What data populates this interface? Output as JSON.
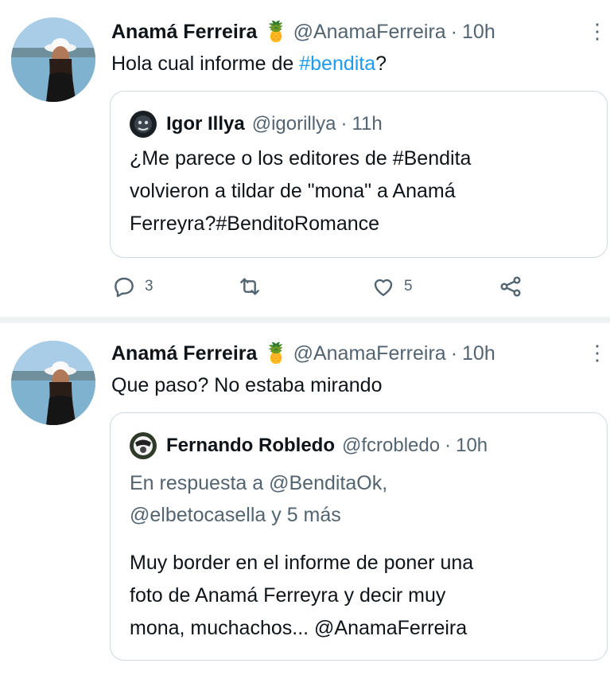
{
  "tweets": [
    {
      "author_name": "Anamá Ferreira",
      "emoji": "🍍",
      "handle": "@AnamaFerreira",
      "separator": "·",
      "time": "10h",
      "text_before": "Hola cual informe de ",
      "text_hashtag": "#bendita",
      "text_after": "?",
      "quote": {
        "author_name": "Igor Illya",
        "handle": "@igorillya",
        "separator": "·",
        "time": "11h",
        "lines": [
          "¿Me parece o los editores de #Bendita",
          "volvieron a tildar de \"mona\" a Anamá",
          "Ferreyra?#BenditoRomance"
        ]
      },
      "actions": {
        "replies": "3",
        "likes": "5"
      }
    },
    {
      "author_name": "Anamá Ferreira",
      "emoji": "🍍",
      "handle": "@AnamaFerreira",
      "separator": "·",
      "time": "10h",
      "text": "Que paso? No estaba mirando",
      "quote": {
        "author_name": "Fernando Robledo",
        "handle": "@fcrobledo",
        "separator": "·",
        "time": "10h",
        "reply_lines": [
          "En respuesta a @BenditaOk,",
          "@elbetocasella y 5 más"
        ],
        "lines": [
          "Muy border en el informe de poner una",
          "foto de Anamá Ferreyra y decir muy",
          "mona, muchachos...  @AnamaFerreira"
        ]
      }
    }
  ],
  "colors": {
    "accent": "#1d9bf0",
    "muted": "#536471",
    "border": "#cfd9de",
    "divider": "#eff3f4"
  },
  "icons": [
    "more-icon",
    "reply-icon",
    "retweet-icon",
    "like-icon",
    "share-icon"
  ]
}
